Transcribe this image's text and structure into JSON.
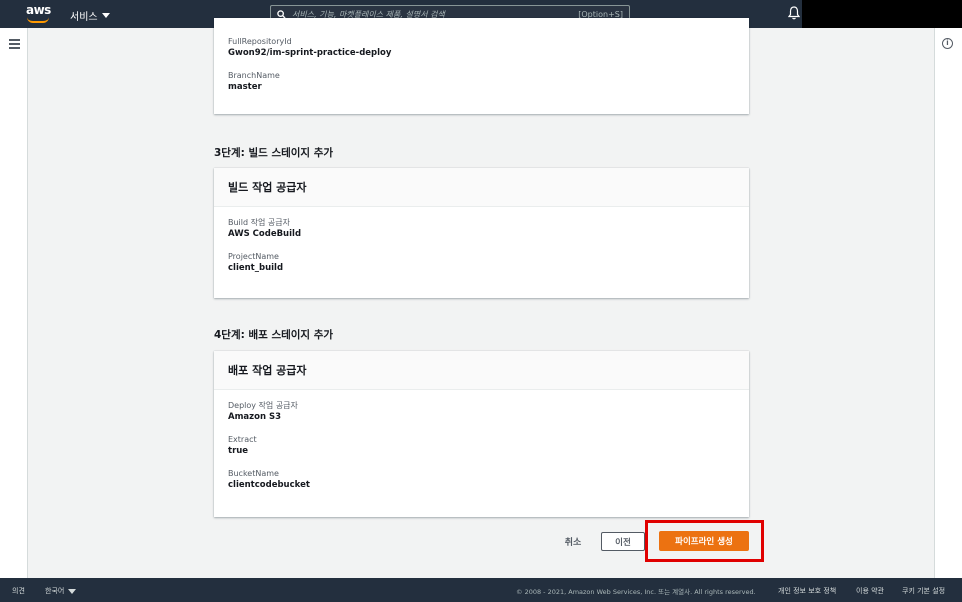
{
  "nav": {
    "logo": "aws",
    "services_label": "서비스",
    "search_placeholder": "서비스, 기능, 마켓플레이스 제품, 설명서 검색",
    "search_shortcut": "[Option+S]"
  },
  "source_card": {
    "fields": [
      {
        "label": "FullRepositoryId",
        "value": "Gwon92/im-sprint-practice-deploy"
      },
      {
        "label": "BranchName",
        "value": "master"
      }
    ]
  },
  "step3": {
    "title": "3단계: 빌드 스테이지 추가",
    "card_title": "빌드 작업 공급자",
    "fields": [
      {
        "label": "Build 작업 공급자",
        "value": "AWS CodeBuild"
      },
      {
        "label": "ProjectName",
        "value": "client_build"
      }
    ]
  },
  "step4": {
    "title": "4단계: 배포 스테이지 추가",
    "card_title": "배포 작업 공급자",
    "fields": [
      {
        "label": "Deploy 작업 공급자",
        "value": "Amazon S3"
      },
      {
        "label": "Extract",
        "value": "true"
      },
      {
        "label": "BucketName",
        "value": "clientcodebucket"
      }
    ]
  },
  "actions": {
    "cancel": "취소",
    "previous": "이전",
    "create": "파이프라인 생성"
  },
  "footer": {
    "feedback": "의견",
    "language": "한국어",
    "copyright": "© 2008 - 2021, Amazon Web Services, Inc. 또는 계열사. All rights reserved.",
    "privacy": "개인 정보 보호 정책",
    "terms": "이용 약관",
    "cookies": "쿠키 기본 설정"
  },
  "colors": {
    "nav_bg": "#232f3e",
    "primary_button": "#ec7211",
    "highlight": "#e00000"
  }
}
